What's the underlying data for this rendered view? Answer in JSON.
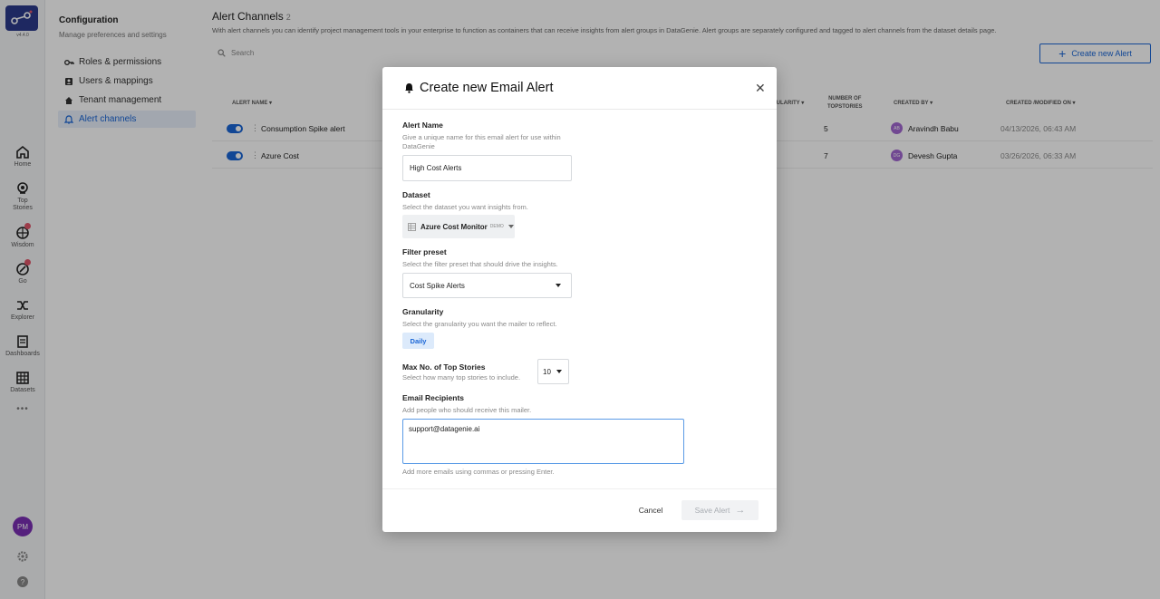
{
  "app": {
    "version": "v4.4.0"
  },
  "rail": {
    "items": [
      {
        "label": "Home",
        "icon": "home-icon"
      },
      {
        "label": "Top Stories",
        "icon": "top-stories-icon"
      },
      {
        "label": "Wisdom",
        "icon": "wisdom-icon"
      },
      {
        "label": "Go",
        "icon": "go-icon"
      },
      {
        "label": "Explorer",
        "icon": "explorer-icon"
      },
      {
        "label": "Dashboards",
        "icon": "dashboards-icon"
      },
      {
        "label": "Datasets",
        "icon": "datasets-icon"
      }
    ],
    "more": "•••",
    "user_initials": "PM"
  },
  "config": {
    "title": "Configuration",
    "subtitle": "Manage preferences and settings",
    "items": [
      {
        "label": "Roles & permissions",
        "icon": "key-icon"
      },
      {
        "label": "Users & mappings",
        "icon": "users-icon"
      },
      {
        "label": "Tenant management",
        "icon": "house-icon"
      },
      {
        "label": "Alert channels",
        "icon": "bell-icon"
      }
    ]
  },
  "main": {
    "title": "Alert Channels",
    "count": "2",
    "description": "With alert channels you can identify project management tools in your enterprise to function as containers that can receive insights from alert groups in DataGenie. Alert groups are separately configured and tagged to alert channels from the dataset details page.",
    "search_placeholder": "Search",
    "create_label": "Create new Alert",
    "columns": {
      "alert_name": "ALERT NAME",
      "granularity": "GRANULARITY",
      "topstories_1": "NUMBER OF",
      "topstories_2": "TOPSTORIES",
      "created_by": "CREATED BY",
      "created_on": "CREATED /MODIFIED ON"
    },
    "rows": [
      {
        "name": "Consumption Spike alert",
        "topstories": "5",
        "initials": "AB",
        "created_by": "Aravindh Babu",
        "created_on": "04/13/2026, 06:43 AM"
      },
      {
        "name": "Azure Cost",
        "topstories": "7",
        "initials": "DG",
        "created_by": "Devesh Gupta",
        "created_on": "03/26/2026, 06:33 AM"
      }
    ]
  },
  "modal": {
    "title": "Create new Email Alert",
    "alert_name": {
      "label": "Alert Name",
      "help": "Give a unique name for this email alert for use within DataGenie",
      "value": "High Cost Alerts"
    },
    "dataset": {
      "label": "Dataset",
      "help": "Select the dataset you want insights from.",
      "value": "Azure Cost Monitor",
      "tag": "DEMO"
    },
    "filter_preset": {
      "label": "Filter preset",
      "help": "Select the filter preset that should drive the insights.",
      "value": "Cost Spike Alerts"
    },
    "granularity": {
      "label": "Granularity",
      "help": "Select the granularity you want the mailer to reflect.",
      "value": "Daily"
    },
    "max_top_stories": {
      "label": "Max No. of Top Stories",
      "help": "Select how many top stories to include.",
      "value": "10"
    },
    "recipients": {
      "label": "Email Recipients",
      "help": "Add people who should receive this mailer.",
      "value": "support@datagenie.ai",
      "hint": "Add more emails using commas or pressing Enter."
    },
    "cancel_label": "Cancel",
    "save_label": "Save Alert"
  },
  "colors": {
    "accent": "#1a66d6",
    "brand": "#2b3a8c",
    "avatar": "#7a2fb3"
  }
}
